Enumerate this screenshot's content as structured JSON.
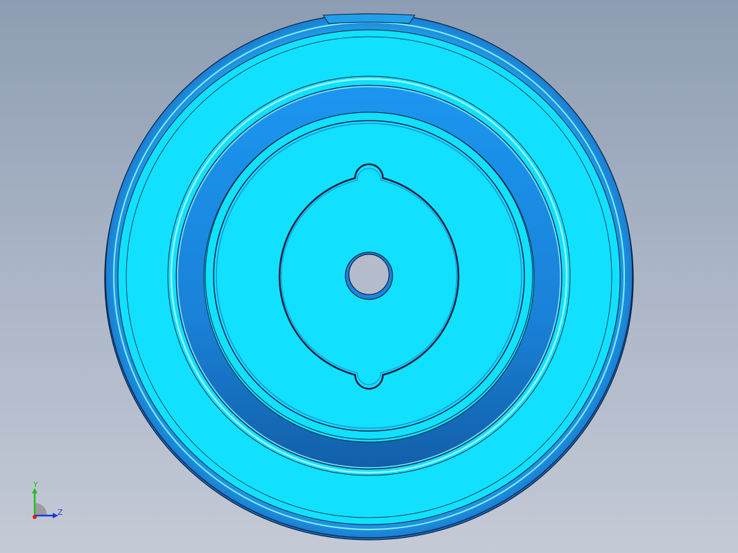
{
  "viewport": {
    "background_top": "#8e9db3",
    "background_bottom": "#c4cad6"
  },
  "part": {
    "face_color": "#12e0ff",
    "dark_color": "#1a78d0",
    "mid_color": "#1e90e6",
    "edge_color": "#0a1f3a",
    "features": [
      "outer-rim",
      "flat-notch",
      "annular-groove",
      "inner-boss",
      "keyed-recess",
      "center-hole"
    ]
  },
  "triad": {
    "y_label": "Y",
    "z_label": "Z",
    "y_color": "#22c022",
    "z_color": "#1c3ad8",
    "x_color": "#e01818"
  }
}
